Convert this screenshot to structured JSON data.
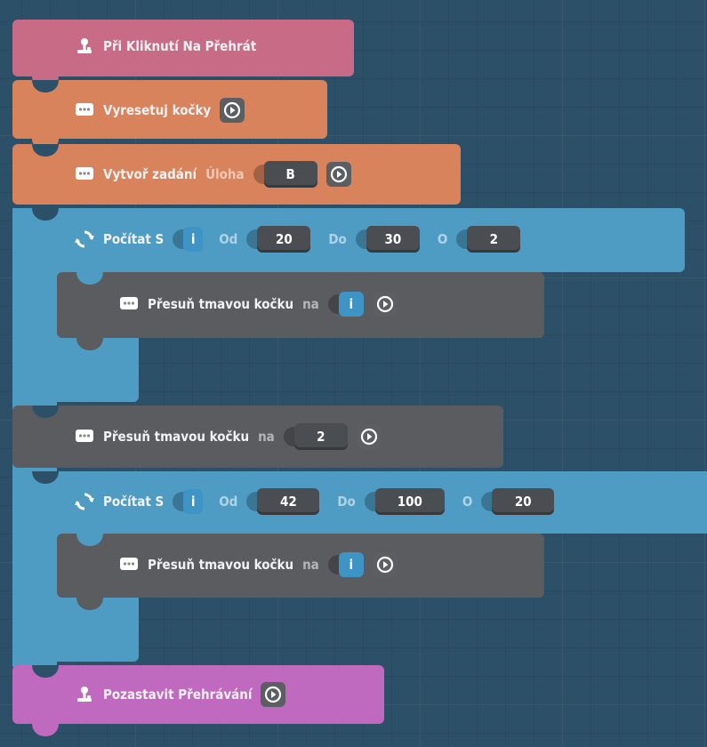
{
  "colors": {
    "event": "#c86b87",
    "action": "#d9835d",
    "loop": "#4e9cc4",
    "move": "#5a5c60",
    "pause": "#bf69bf"
  },
  "event_block": {
    "label": "Při Kliknutí Na Přehrát",
    "icon": "joystick-icon"
  },
  "reset_block": {
    "label": "Vyresetuj kočky",
    "icon": "chat-icon"
  },
  "task_block": {
    "label": "Vytvoř zadání",
    "param_keyword": "Úloha",
    "param_value": "B",
    "icon": "chat-icon"
  },
  "loop1": {
    "label": "Počítat S",
    "var": "i",
    "from_kw": "Od",
    "from": "20",
    "to_kw": "Do",
    "to": "30",
    "step_kw": "O",
    "step": "2",
    "icon": "refresh-icon"
  },
  "move1": {
    "label": "Přesuň tmavou kočku",
    "kw": "na",
    "var": "i"
  },
  "move2": {
    "label": "Přesuň tmavou kočku",
    "kw": "na",
    "value": "2"
  },
  "loop2": {
    "label": "Počítat S",
    "var": "i",
    "from_kw": "Od",
    "from": "42",
    "to_kw": "Do",
    "to": "100",
    "step_kw": "O",
    "step": "20",
    "icon": "refresh-icon"
  },
  "move3": {
    "label": "Přesuň tmavou kočku",
    "kw": "na",
    "var": "i"
  },
  "pause_block": {
    "label": "Pozastavit Přehrávání",
    "icon": "joystick-icon"
  }
}
